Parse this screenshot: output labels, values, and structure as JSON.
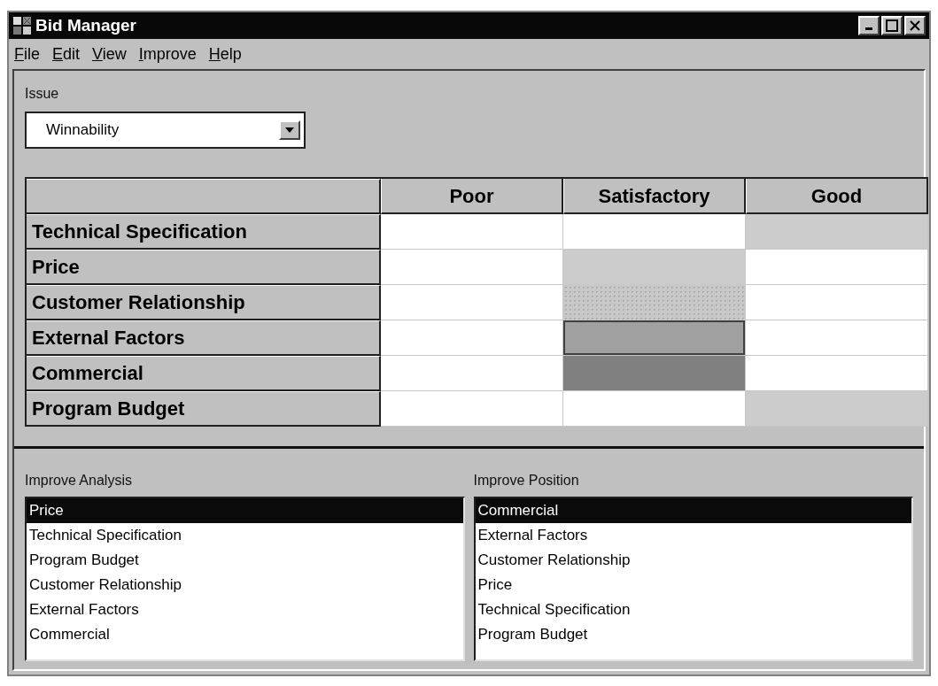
{
  "window": {
    "title": "Bid Manager"
  },
  "menu": [
    {
      "label": "File",
      "underlined": true
    },
    {
      "label": "Edit",
      "underlined": true
    },
    {
      "label": "View",
      "underlined": true
    },
    {
      "label": "Improve",
      "underlined": true
    },
    {
      "label": "Help",
      "underlined": true
    }
  ],
  "issue": {
    "label": "Issue",
    "value": "Winnability"
  },
  "grid": {
    "columns": [
      "Poor",
      "Satisfactory",
      "Good"
    ],
    "rows": [
      {
        "label": "Technical Specification",
        "cells": [
          {
            "kind": "blank"
          },
          {
            "kind": "blank"
          },
          {
            "kind": "light"
          }
        ]
      },
      {
        "label": "Price",
        "cells": [
          {
            "kind": "blank"
          },
          {
            "kind": "light"
          },
          {
            "kind": "blank"
          }
        ]
      },
      {
        "label": "Customer Relationship",
        "cells": [
          {
            "kind": "blank"
          },
          {
            "kind": "dotted"
          },
          {
            "kind": "blank"
          }
        ]
      },
      {
        "label": "External Factors",
        "cells": [
          {
            "kind": "blank"
          },
          {
            "kind": "framed"
          },
          {
            "kind": "blank"
          }
        ]
      },
      {
        "label": "Commercial",
        "cells": [
          {
            "kind": "blank"
          },
          {
            "kind": "dark"
          },
          {
            "kind": "blank"
          }
        ]
      },
      {
        "label": "Program Budget",
        "cells": [
          {
            "kind": "blank"
          },
          {
            "kind": "blank"
          },
          {
            "kind": "light"
          }
        ]
      }
    ]
  },
  "lists": [
    {
      "label": "Improve Analysis",
      "items": [
        {
          "text": "Price",
          "selected": true
        },
        {
          "text": "Technical Specification",
          "selected": false
        },
        {
          "text": "Program Budget",
          "selected": false
        },
        {
          "text": "Customer Relationship",
          "selected": false
        },
        {
          "text": "External Factors",
          "selected": false
        },
        {
          "text": "Commercial",
          "selected": false
        }
      ]
    },
    {
      "label": "Improve Position",
      "items": [
        {
          "text": "Commercial",
          "selected": true
        },
        {
          "text": "External Factors",
          "selected": false
        },
        {
          "text": "Customer Relationship",
          "selected": false
        },
        {
          "text": "Price",
          "selected": false
        },
        {
          "text": "Technical Specification",
          "selected": false
        },
        {
          "text": "Program Budget",
          "selected": false
        }
      ]
    }
  ]
}
